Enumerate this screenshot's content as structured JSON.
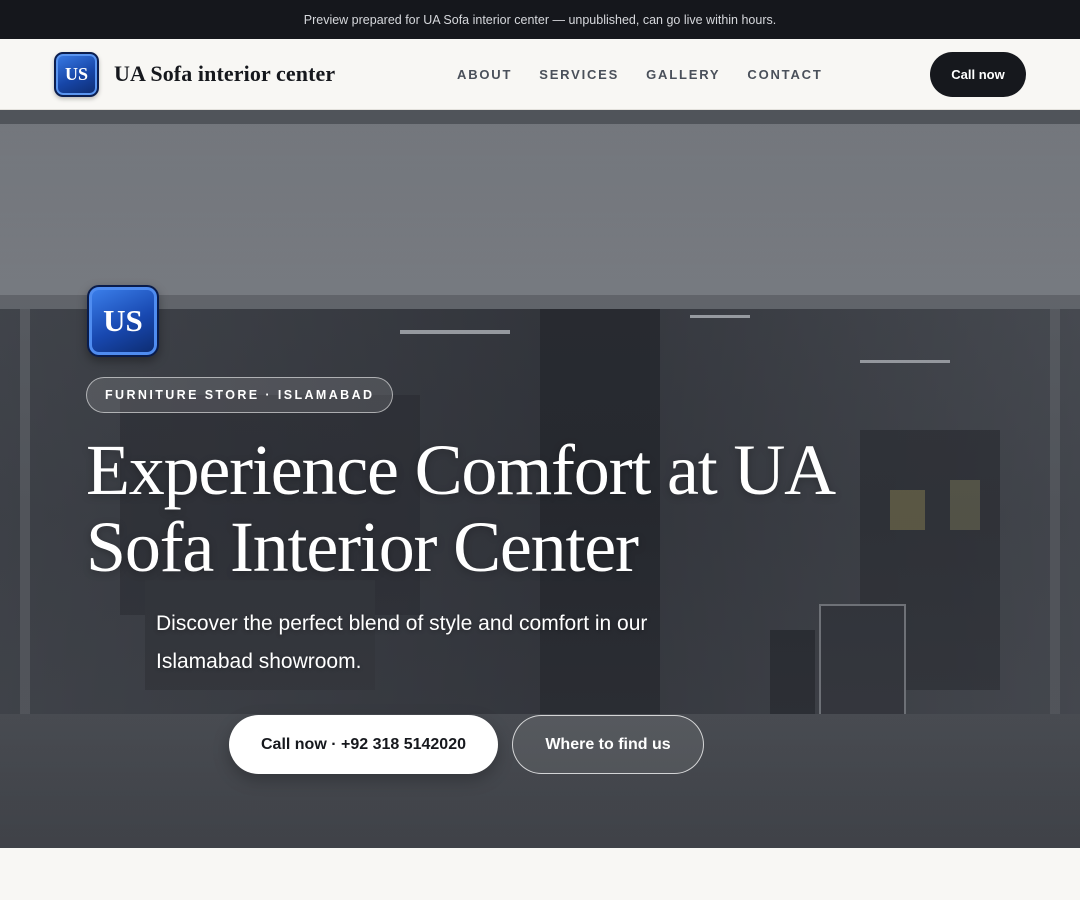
{
  "preview_banner": "Preview prepared for UA Sofa interior center — unpublished, can go live within hours.",
  "header": {
    "logo_text": "US",
    "brand_name": "UA Sofa interior center",
    "nav": [
      "ABOUT",
      "SERVICES",
      "GALLERY",
      "CONTACT"
    ],
    "cta_label": "Call now"
  },
  "hero": {
    "logo_text": "US",
    "tag": "FURNITURE STORE · ISLAMABAD",
    "title": "Experience Comfort at UA Sofa Interior Center",
    "subtitle": "Discover the perfect blend of style and comfort in our Islamabad showroom.",
    "primary_button": "Call now · +92 318 5142020",
    "secondary_button": "Where to find us",
    "background_image": "showroom-storefront-photo"
  },
  "colors": {
    "banner_bg": "#15171c",
    "header_bg": "#f8f7f4",
    "dark_button": "#16181d",
    "logo_blue": "#1746a8",
    "nav_text": "#4a505a"
  }
}
